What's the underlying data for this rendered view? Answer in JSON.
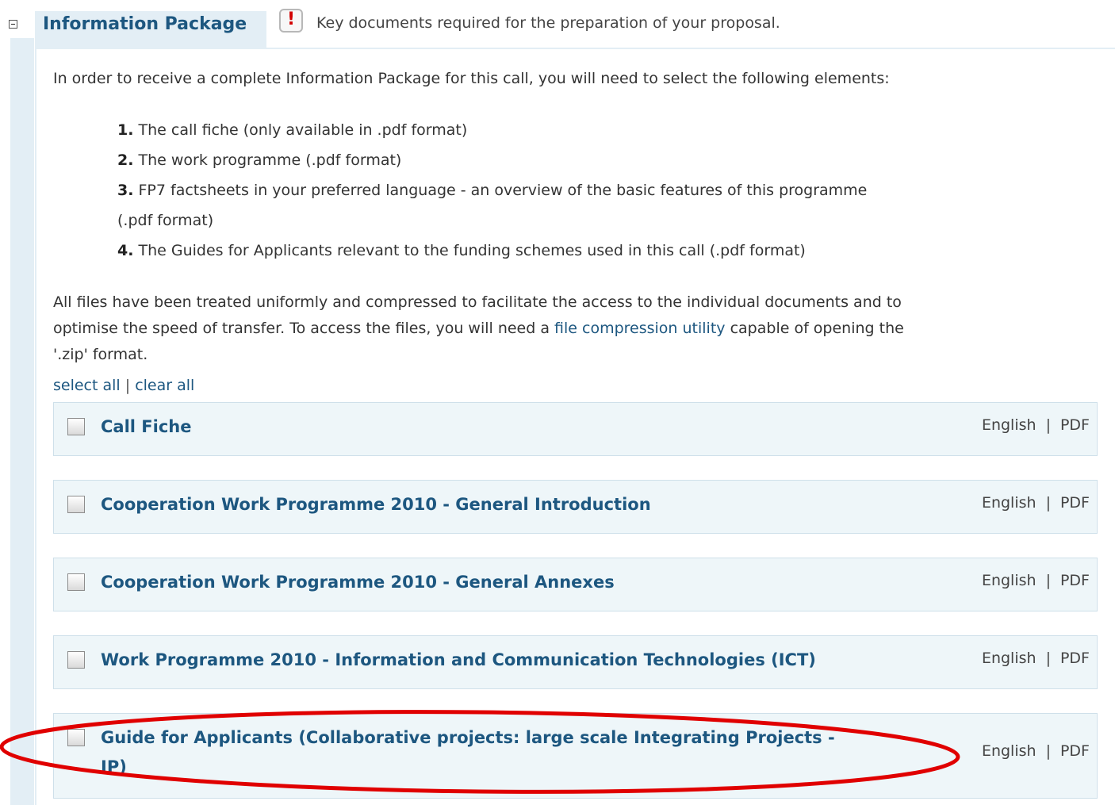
{
  "section": {
    "tab_label": "Information Package",
    "description": "Key documents required for the preparation of your proposal."
  },
  "intro_text": "In order to receive a complete Information Package for this call, you will need to select the following elements:",
  "list": [
    {
      "num": "1.",
      "text": "The call fiche (only available in .pdf format)"
    },
    {
      "num": "2.",
      "text": "The work programme (.pdf format)"
    },
    {
      "num": "3.",
      "text": "FP7 factsheets in your preferred language - an overview of the basic features of this programme",
      "text2": "(.pdf format)"
    },
    {
      "num": "4.",
      "text": "The Guides for Applicants relevant to the funding schemes used in this call (.pdf format)"
    }
  ],
  "note": {
    "part1": "All files have been treated uniformly and compressed to facilitate the access to the individual documents and to",
    "part2_before": "optimise the speed of transfer. To access the files, you will need a ",
    "link_text": "file compression utility",
    "part2_after": " capable of opening the",
    "part3": "'.zip' format."
  },
  "select_all_label": "select all",
  "separator": "|",
  "clear_all_label": "clear all",
  "documents": [
    {
      "title": "Call Fiche",
      "language": "English",
      "format": "PDF"
    },
    {
      "title": "Cooperation Work Programme 2010 - General Introduction",
      "language": "English",
      "format": "PDF"
    },
    {
      "title": "Cooperation Work Programme 2010 - General Annexes",
      "language": "English",
      "format": "PDF"
    },
    {
      "title": "Work Programme 2010 - Information and Communication Technologies (ICT)",
      "language": "English",
      "format": "PDF"
    },
    {
      "title": "Guide for Applicants (Collaborative projects: large scale Integrating Projects -",
      "title2": "IP)",
      "language": "English",
      "format": "PDF"
    }
  ],
  "colors": {
    "link": "#1d5780",
    "tab_bg": "#e3eef5",
    "row_bg": "#eef6f9",
    "annotation": "#e00000",
    "warning": "#d20000"
  },
  "icons": {
    "toggle": "collapse-minus-icon",
    "warning": "exclamation-icon"
  }
}
